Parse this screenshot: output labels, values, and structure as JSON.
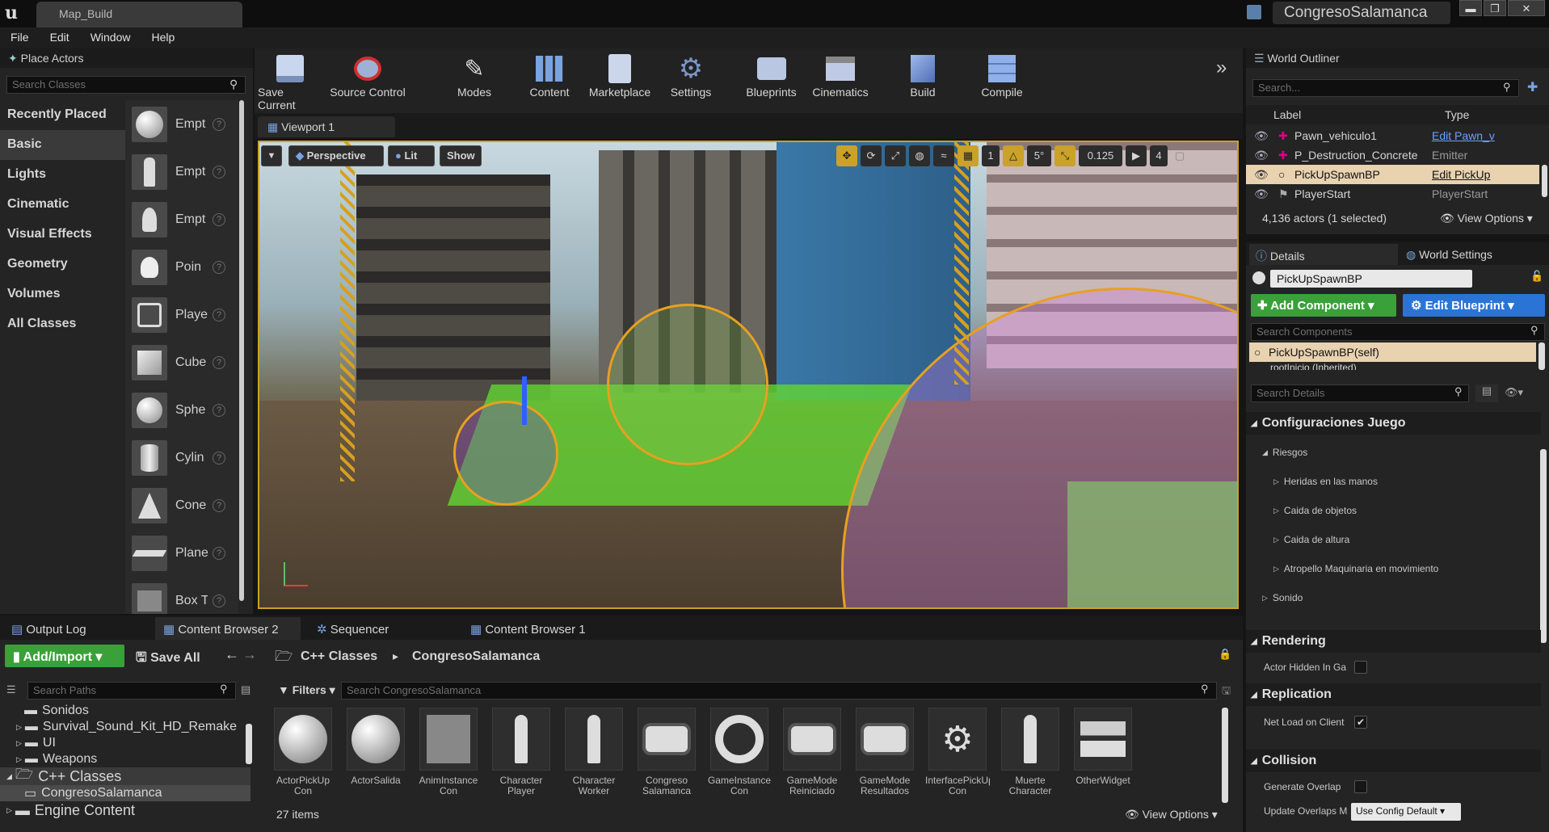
{
  "window": {
    "tab": "Map_Build",
    "project": "CongresoSalamanca",
    "min": "▬",
    "max": "❐",
    "close": "✕"
  },
  "menu": [
    "File",
    "Edit",
    "Window",
    "Help"
  ],
  "place_actors": {
    "title": "Place Actors",
    "search_placeholder": "Search Classes",
    "categories": [
      "Recently Placed",
      "Basic",
      "Lights",
      "Cinematic",
      "Visual Effects",
      "Geometry",
      "Volumes",
      "All Classes"
    ],
    "items": [
      "Empt",
      "Empt",
      "Empt",
      "Poin",
      "Playe",
      "Cube",
      "Sphe",
      "Cylin",
      "Cone",
      "Plane",
      "Box T"
    ]
  },
  "toolbar": [
    "Save Current",
    "Source Control",
    "Modes",
    "Content",
    "Marketplace",
    "Settings",
    "Blueprints",
    "Cinematics",
    "Build",
    "Compile"
  ],
  "viewport": {
    "tab": "Viewport 1",
    "perspective": "Perspective",
    "lit": "Lit",
    "show": "Show",
    "angle": "5°",
    "scale": "0.125",
    "cam": "4",
    "grid": "1"
  },
  "outliner": {
    "title": "World Outliner",
    "search_placeholder": "Search...",
    "col_label": "Label",
    "col_type": "Type",
    "rows": [
      {
        "label": "Pawn_vehiculo1",
        "type": "Edit Pawn_v"
      },
      {
        "label": "P_Destruction_Concrete",
        "type": "Emitter"
      },
      {
        "label": "PickUpSpawnBP",
        "type": "Edit PickUp"
      },
      {
        "label": "PlayerStart",
        "type": "PlayerStart"
      }
    ],
    "status": "4,136 actors (1 selected)",
    "view_options": "View Options"
  },
  "details": {
    "tab_details": "Details",
    "tab_world": "World Settings",
    "name": "PickUpSpawnBP",
    "add_component": "Add Component",
    "edit_blueprint": "Edit Blueprint",
    "search_components": "Search Components",
    "component_self": "PickUpSpawnBP(self)",
    "component_inherited": "rootInicio (Inherited)",
    "search_details": "Search Details",
    "section_config": "Configuraciones Juego",
    "riesgos": "Riesgos",
    "riesgo_items": [
      "Heridas en las manos",
      "Caida de objetos",
      "Caida de altura",
      "Atropello Maquinaria en movimiento"
    ],
    "sonido": "Sonido",
    "rendering": "Rendering",
    "actor_hidden": "Actor Hidden In Ga",
    "replication": "Replication",
    "net_load": "Net Load on Client",
    "collision": "Collision",
    "gen_overlap": "Generate Overlap",
    "update_overlaps": "Update Overlaps M",
    "config_default": "Use Config Default"
  },
  "bottom_tabs": [
    "Output Log",
    "Content Browser 2",
    "Sequencer",
    "Content Browser 1"
  ],
  "content": {
    "add_import": "Add/Import",
    "save_all": "Save All",
    "crumb1": "C++ Classes",
    "crumb2": "CongresoSalamanca",
    "search_paths": "Search Paths",
    "filters": "Filters",
    "search_content": "Search CongresoSalamanca",
    "tree": [
      "Sonidos",
      "Survival_Sound_Kit_HD_Remake",
      "UI",
      "Weapons",
      "C++ Classes",
      "CongresoSalamanca",
      "Engine Content"
    ],
    "assets": [
      "ActorPickUp Con",
      "ActorSalida",
      "AnimInstance Con",
      "Character Player",
      "Character Worker",
      "Congreso Salamanca",
      "GameInstance Con",
      "GameMode Reiniciado",
      "GameMode Resultados",
      "InterfacePickUp Con",
      "Muerte Character",
      "OtherWidget"
    ],
    "count": "27 items",
    "view_options": "View Options"
  }
}
